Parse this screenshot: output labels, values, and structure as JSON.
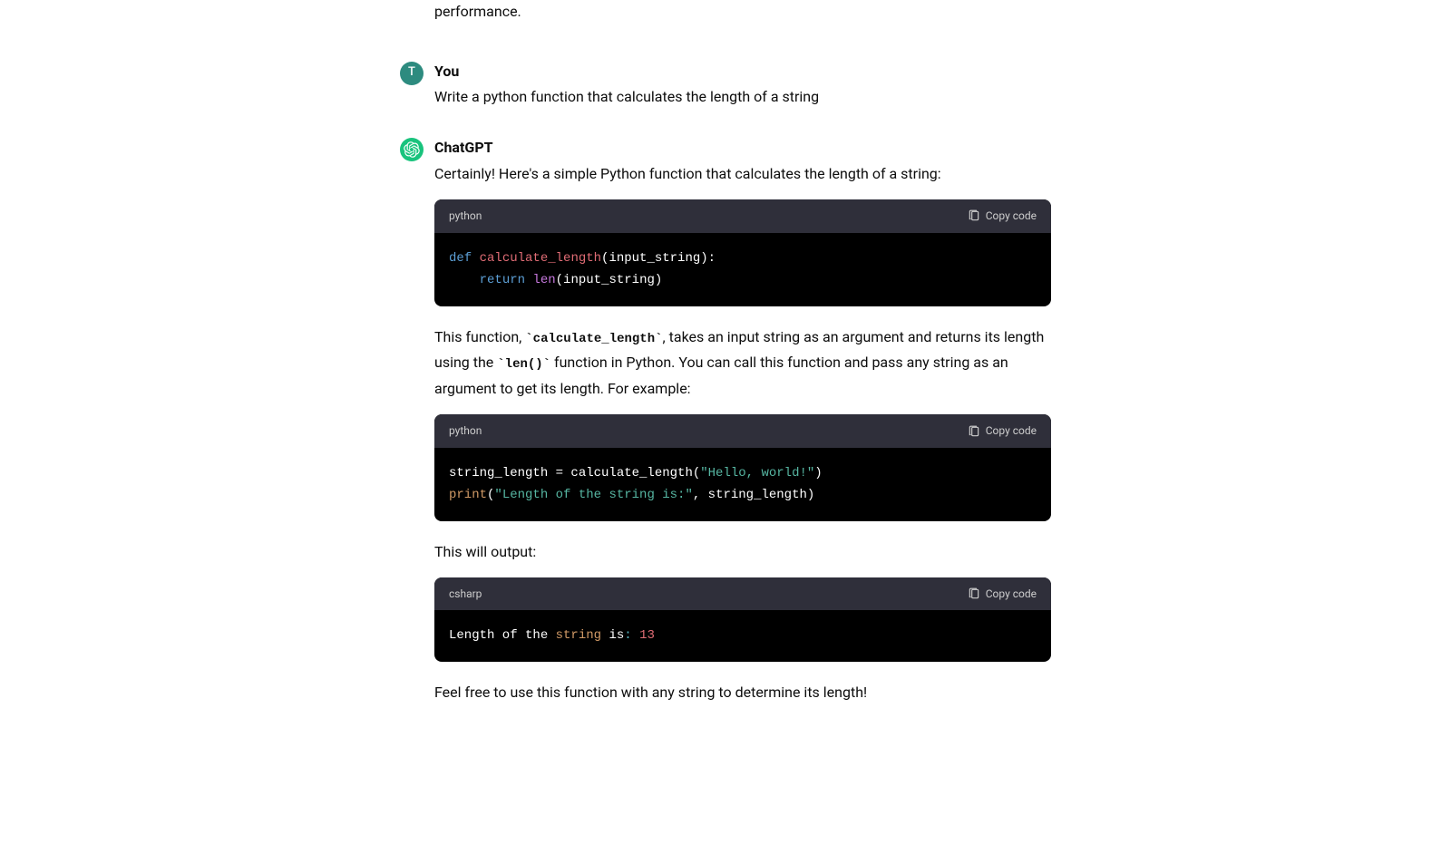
{
  "partialTop": "performance.",
  "userMessage": {
    "author": "You",
    "avatarLetter": "T",
    "text": "Write a python function that calculates the length of a string"
  },
  "assistantMessage": {
    "author": "ChatGPT",
    "intro": "Certainly! Here's a simple Python function that calculates the length of a string:",
    "codeBlock1": {
      "lang": "python",
      "copyLabel": "Copy code"
    },
    "explain1_part1": "This function, ",
    "explain1_code1": "`calculate_length`",
    "explain1_part2": ", takes an input string as an argument and returns its length using the ",
    "explain1_code2": "`len()`",
    "explain1_part3": " function in Python. You can call this function and pass any string as an argument to get its length. For example:",
    "codeBlock2": {
      "lang": "python",
      "copyLabel": "Copy code"
    },
    "explain2": "This will output:",
    "codeBlock3": {
      "lang": "csharp",
      "copyLabel": "Copy code"
    },
    "closing": "Feel free to use this function with any string to determine its length!"
  },
  "code1": {
    "def": "def",
    "fname": "calculate_length",
    "params": "(input_string):",
    "ret": "return",
    "builtin": "len",
    "call": "(input_string)"
  },
  "code2": {
    "line1a": "string_length = calculate_length(",
    "line1b": "\"Hello, world!\"",
    "line1c": ")",
    "line2a": "print",
    "line2b": "(",
    "line2c": "\"Length of the string is:\"",
    "line2d": ", string_length)"
  },
  "code3": {
    "part1": "Length of the ",
    "part2": "string",
    "part3": " is",
    "part4": ": ",
    "part5": "13"
  }
}
